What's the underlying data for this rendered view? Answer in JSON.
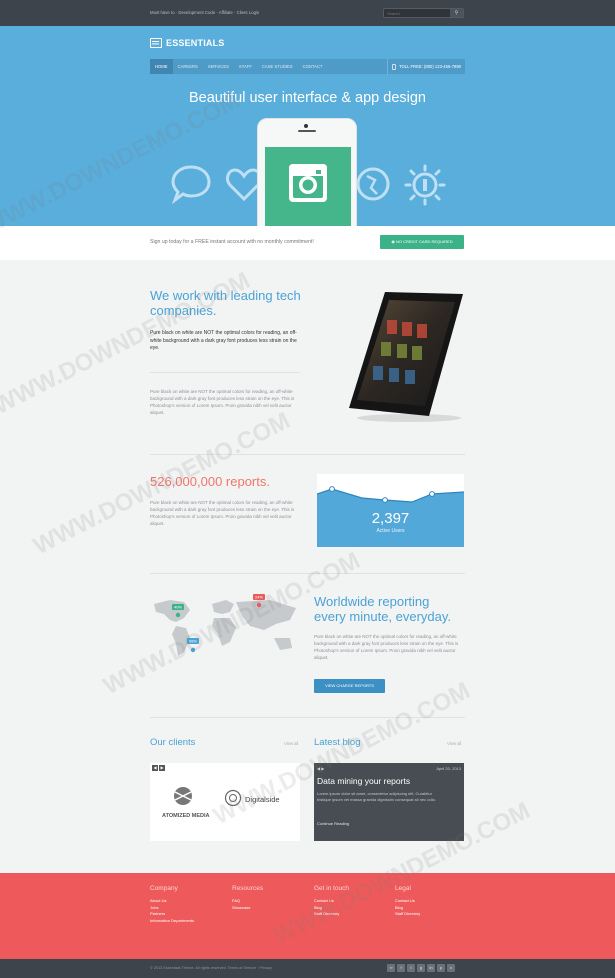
{
  "topbar": {
    "breadcrumb": "Must have to · Development Code · Affiliate · Client Login",
    "search_placeholder": "Search",
    "search_button_icon": "search-icon"
  },
  "brand": {
    "name": "ESSENTIALS",
    "logo_icon": "grid-logo-icon"
  },
  "nav": {
    "items": [
      "HOME",
      "CAREERS",
      "SERVICES",
      "STAFF",
      "CASE STUDIES",
      "CONTACT"
    ],
    "active": "HOME",
    "phone": "TOLL FREE: (800) 123-456-7890",
    "phone_icon": "mobile-icon"
  },
  "hero": {
    "headline": "Beautiful user interface & app design",
    "icons": [
      "chat-icon",
      "heart-icon",
      "instagram-icon",
      "globe-icon",
      "settings-icon"
    ],
    "colors": {
      "background": "#5aaedc",
      "screen": "#45b58b"
    }
  },
  "signup": {
    "text": "Sign up today for a FREE instant account with no monthly commitment!",
    "button": "NO CREDIT CARD REQUIRED"
  },
  "section1": {
    "title": "We work with leading tech companies.",
    "lead": "Pure black on white are NOT the optimal colors for reading, an off-white background with a dark gray font produces less strain on the eye.",
    "paragraph": "Pure black on white are NOT the optimal colors for reading, an off-white background with a dark gray font produces less strain on the eye. This is Photoshop's version of Lorem Ipsum. Proin gravida nibh vel velit auctor aliquet."
  },
  "section2": {
    "title": "526,000,000 reports.",
    "paragraph": "Pure black on white are NOT the optimal colors for reading, an off-white background with a dark gray font produces less strain on the eye. This is Photoshop's version of Lorem Ipsum. Proin gravida nibh vel velit auctor aliquet.",
    "widget": {
      "value": "2,397",
      "label": "Active Users",
      "color": "#52a8d9"
    }
  },
  "section3": {
    "title": "Worldwide reporting every minute, everyday.",
    "paragraph": "Pure black on white are NOT the optimal colors for reading, an off-white background with a dark gray font produces less strain on the eye. This is Photoshop's version of Lorem Ipsum. Proin gravida nibh vel velit auctor aliquet.",
    "button": "VIEW CHARGE REPORTS",
    "map_pins": [
      "40%",
      "24%",
      "98%"
    ]
  },
  "clients": {
    "title": "Our clients",
    "view_all": "View all",
    "logos": [
      "ATOMIZED MEDIA",
      "Digitalside"
    ]
  },
  "blog": {
    "title": "Latest blog",
    "view_all": "View all",
    "post_title": "Data mining your reports",
    "post_date": "April 20, 2013",
    "post_excerpt": "Lorem ipsum dolor sit amet, consectetur adipiscing elit. Curabitur tristique ipsum vel massa gravida dignissim consequat sit nec odio.",
    "read_more": "Continue Reading"
  },
  "footer": {
    "columns": [
      {
        "title": "Company",
        "links": [
          "About Us",
          "Jobs",
          "Partners",
          "Information Departments"
        ]
      },
      {
        "title": "Resources",
        "links": [
          "FAQ",
          "Showcase"
        ]
      },
      {
        "title": "Get in touch",
        "links": [
          "Contact Us",
          "Blog",
          "Staff Directory"
        ]
      },
      {
        "title": "Legal",
        "links": [
          "Contact Us",
          "Blog",
          "Staff Directory"
        ]
      }
    ],
    "copyright": "© 2013 Essentials Theme. All rights reserved. Terms of Service · Privacy",
    "social_icons": [
      "rss-icon",
      "facebook-icon",
      "twitter-icon",
      "google-icon",
      "linkedin-icon",
      "pinterest-icon",
      "vimeo-icon"
    ],
    "color": "#ee5a5b"
  },
  "watermark": "WWW.DOWNDEMO.COM"
}
